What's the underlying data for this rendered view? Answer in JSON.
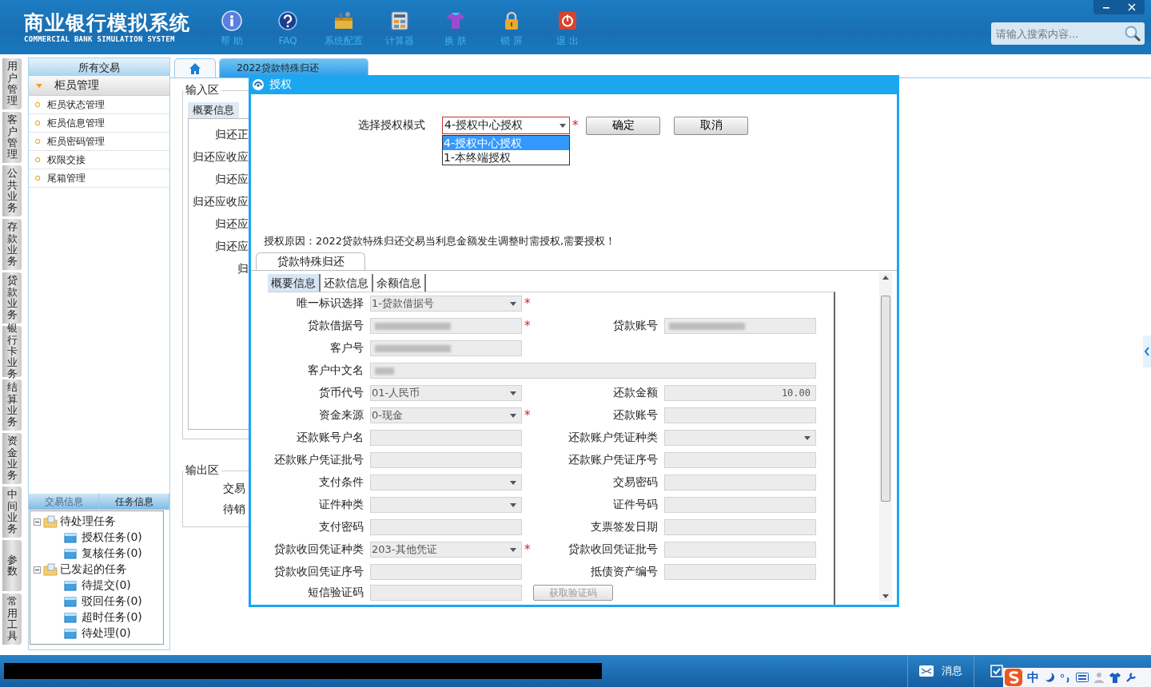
{
  "app": {
    "title": "商业银行模拟系统",
    "subtitle": "COMMERCIAL BANK SIMULATION SYSTEM"
  },
  "toolbar": [
    {
      "label": "帮 助",
      "kind": "info"
    },
    {
      "label": "FAQ",
      "kind": "question"
    },
    {
      "label": "系统配置",
      "kind": "toolbox"
    },
    {
      "label": "计算器",
      "kind": "calculator"
    },
    {
      "label": "换 肤",
      "kind": "shirt"
    },
    {
      "label": "锁 屏",
      "kind": "lock"
    },
    {
      "label": "退 出",
      "kind": "power"
    }
  ],
  "search": {
    "placeholder": "请输入搜索内容..."
  },
  "side_tabs": [
    "用户管理",
    "客户管理",
    "公共业务",
    "存款业务",
    "贷款业务",
    "银行卡业务",
    "结算业务",
    "资金业务",
    "中间业务",
    "参数",
    "常用工具"
  ],
  "sidebar": {
    "header": "所有交易",
    "group": {
      "label": "柜员管理",
      "expanded": true,
      "items": [
        "柜员状态管理",
        "柜员信息管理",
        "柜员密码管理",
        "权限交接",
        "尾箱管理"
      ]
    }
  },
  "task_panel": {
    "tabs": [
      {
        "label": "交易信息",
        "selected": false
      },
      {
        "label": "任务信息",
        "selected": true
      }
    ],
    "tree": [
      {
        "label": "待处理任务",
        "expanded": true,
        "children": [
          {
            "label": "授权任务(0)"
          },
          {
            "label": "复核任务(0)"
          }
        ]
      },
      {
        "label": "已发起的任务",
        "expanded": true,
        "children": [
          {
            "label": "待提交(0)"
          },
          {
            "label": "驳回任务(0)"
          },
          {
            "label": "超时任务(0)"
          },
          {
            "label": "待处理(0)"
          }
        ]
      }
    ]
  },
  "main_tabs": [
    {
      "kind": "home",
      "selected": false
    },
    {
      "kind": "page",
      "label": "2022贷款特殊归还",
      "selected": true
    }
  ],
  "input_area": {
    "legend": "输入区",
    "tab": "概要信息",
    "labels": [
      "归还正",
      "归还应收应",
      "归还应",
      "归还应收应",
      "归还应",
      "归还应",
      "归"
    ]
  },
  "output_area": {
    "legend": "输出区",
    "labels": [
      "交易",
      "待销"
    ]
  },
  "dialog": {
    "title": "授权",
    "mode_label": "选择授权模式",
    "mode_value": "4-授权中心授权",
    "required": true,
    "required_mark": "*",
    "options": [
      {
        "label": "4-授权中心授权",
        "selected": true
      },
      {
        "label": "1-本终端授权",
        "selected": false
      }
    ],
    "buttons": [
      "确定",
      "取消"
    ],
    "reason": "授权原因：2022贷款特殊归还交易当利息金额发生调整时需授权,需要授权！",
    "form_tab": "贷款特殊归还",
    "sub_tabs": [
      {
        "label": "概要信息",
        "selected": true
      },
      {
        "label": "还款信息",
        "selected": false
      },
      {
        "label": "余额信息",
        "selected": false
      }
    ],
    "rows": [
      {
        "left": {
          "label": "唯一标识选择",
          "kind": "select",
          "value": "1-贷款借据号",
          "required": true
        }
      },
      {
        "left": {
          "label": "贷款借据号",
          "kind": "blurred",
          "required": true
        },
        "right": {
          "label": "贷款账号",
          "kind": "blurred"
        }
      },
      {
        "left": {
          "label": "客户号",
          "kind": "blurred",
          "required": false
        }
      },
      {
        "left": {
          "label": "客户中文名",
          "kind": "blurred",
          "required": false,
          "wide": true
        }
      },
      {
        "left": {
          "label": "货币代号",
          "kind": "select",
          "value": "01-人民币",
          "required": false
        },
        "right": {
          "label": "还款金额",
          "kind": "amount",
          "value": "10.00"
        }
      },
      {
        "left": {
          "label": "资金来源",
          "kind": "select",
          "value": "0-现金",
          "required": true
        },
        "right": {
          "label": "还款账号",
          "kind": "text"
        }
      },
      {
        "left": {
          "label": "还款账号户名",
          "kind": "text",
          "required": false
        },
        "right": {
          "label": "还款账户凭证种类",
          "kind": "select"
        }
      },
      {
        "left": {
          "label": "还款账户凭证批号",
          "kind": "text",
          "required": false
        },
        "right": {
          "label": "还款账户凭证序号",
          "kind": "text"
        }
      },
      {
        "left": {
          "label": "支付条件",
          "kind": "select",
          "required": false
        },
        "right": {
          "label": "交易密码",
          "kind": "text"
        }
      },
      {
        "left": {
          "label": "证件种类",
          "kind": "select",
          "required": false
        },
        "right": {
          "label": "证件号码",
          "kind": "text"
        }
      },
      {
        "left": {
          "label": "支付密码",
          "kind": "text",
          "required": false
        },
        "right": {
          "label": "支票签发日期",
          "kind": "text"
        }
      },
      {
        "left": {
          "label": "贷款收回凭证种类",
          "kind": "select",
          "value": "203-其他凭证",
          "required": true
        },
        "right": {
          "label": "贷款收回凭证批号",
          "kind": "text"
        }
      },
      {
        "left": {
          "label": "贷款收回凭证序号",
          "kind": "text",
          "required": false
        },
        "right": {
          "label": "抵债资产编号",
          "kind": "text"
        }
      },
      {
        "left": {
          "label": "短信验证码",
          "kind": "text",
          "required": false
        },
        "button": {
          "label": "获取验证码",
          "disabled": true
        }
      }
    ]
  },
  "status_bar": {
    "items": [
      {
        "label": "消息",
        "kind": "mail"
      }
    ],
    "ime_label": "中"
  }
}
